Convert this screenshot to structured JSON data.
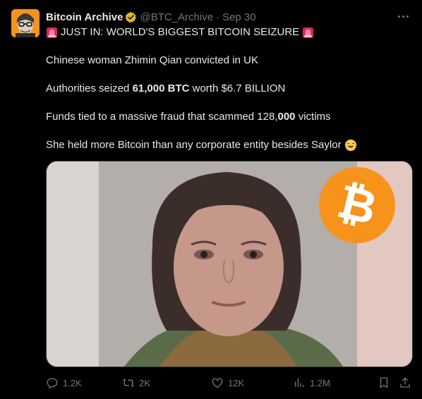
{
  "author": {
    "name": "Bitcoin Archive",
    "handle": "@BTC_Archive",
    "separator": "·",
    "date": "Sep 30"
  },
  "body": {
    "headline": "JUST IN: WORLD'S BIGGEST BITCOIN SEIZURE",
    "line2": "Chinese woman Zhimin Qian convicted in UK",
    "line3_pre": "Authorities seized ",
    "line3_bold": "61,000 BTC",
    "line3_post": " worth $6.7 BILLION",
    "line4_pre": "Funds tied to a massive fraud that scammed 128,",
    "line4_bold": "000",
    "line4_post": " victims",
    "line5": "She held more Bitcoin than any corporate entity besides Saylor"
  },
  "media": {
    "logo_glyph": "₿"
  },
  "actions": {
    "replies": "1.2K",
    "reposts": "2K",
    "likes": "12K",
    "views": "1.2M"
  },
  "icons": [
    "verified-badge-icon",
    "siren-emoji-icon",
    "laughing-emoji-icon",
    "more-icon",
    "reply-icon",
    "repost-icon",
    "like-icon",
    "views-icon",
    "bookmark-icon",
    "share-icon"
  ],
  "colors": {
    "background": "#000000",
    "text": "#e7e9ea",
    "secondary": "#71767b",
    "bitcoin_orange": "#f7931a",
    "verified_gold": "#e2b719"
  }
}
